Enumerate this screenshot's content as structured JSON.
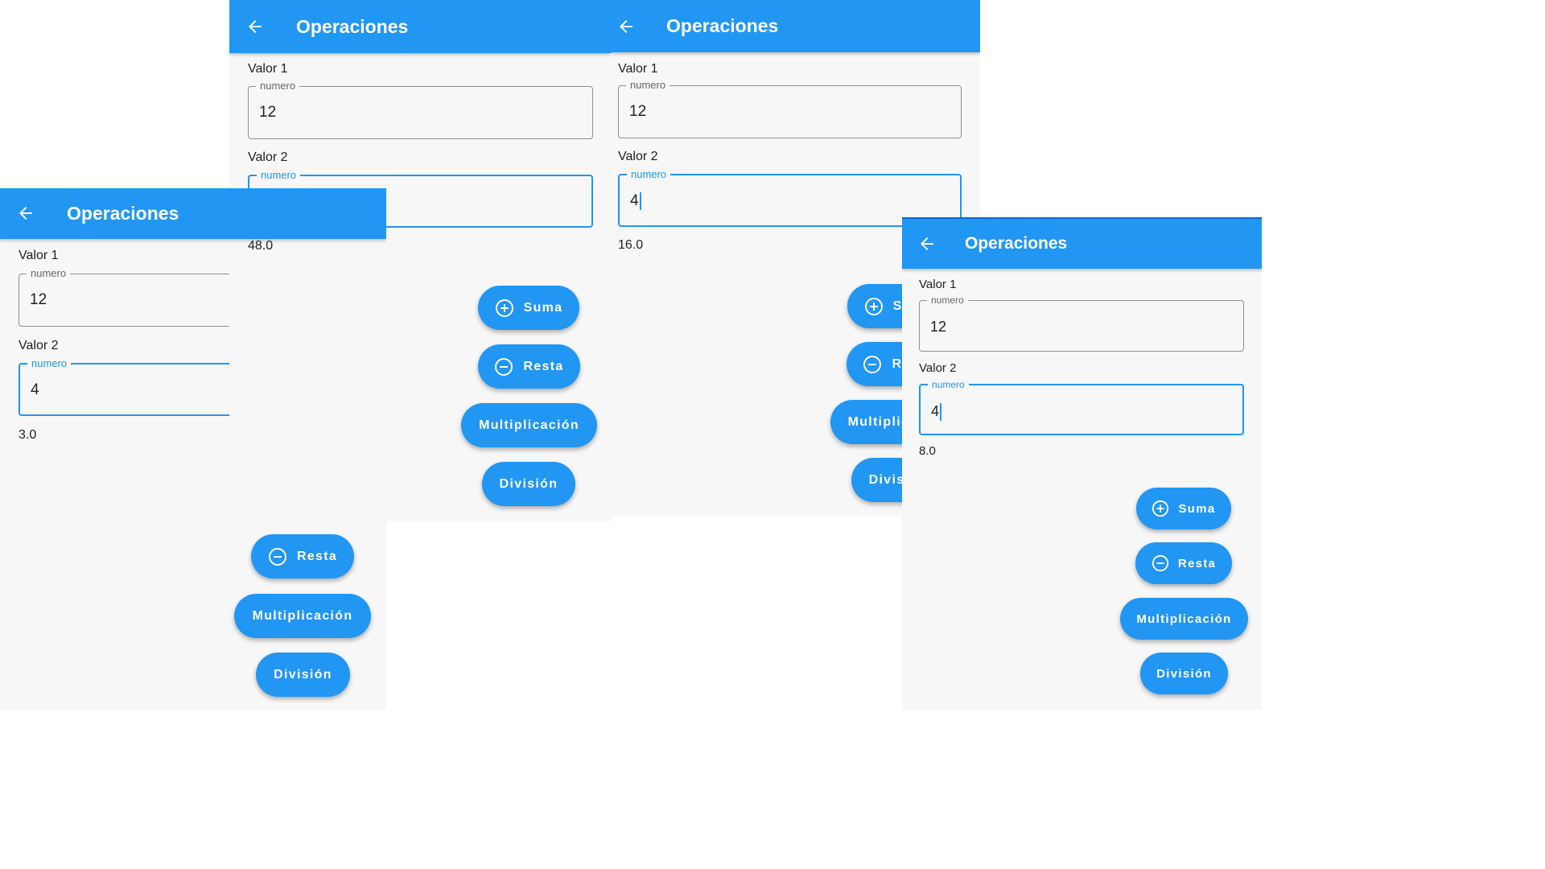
{
  "app": {
    "title": "Operaciones"
  },
  "form": {
    "label1": "Valor 1",
    "label2": "Valor 2",
    "hint": "numero",
    "value1": "12",
    "value2": "4"
  },
  "buttons": {
    "suma": "Suma",
    "resta": "Resta",
    "multiplicacion": "Multiplicación",
    "division": "División"
  },
  "screens": [
    {
      "result": "3.0"
    },
    {
      "result": "48.0"
    },
    {
      "result": "16.0"
    },
    {
      "result": "8.0"
    }
  ],
  "colors": {
    "primary": "#2196f3",
    "background": "#f7f7f7",
    "text": "#222222"
  }
}
